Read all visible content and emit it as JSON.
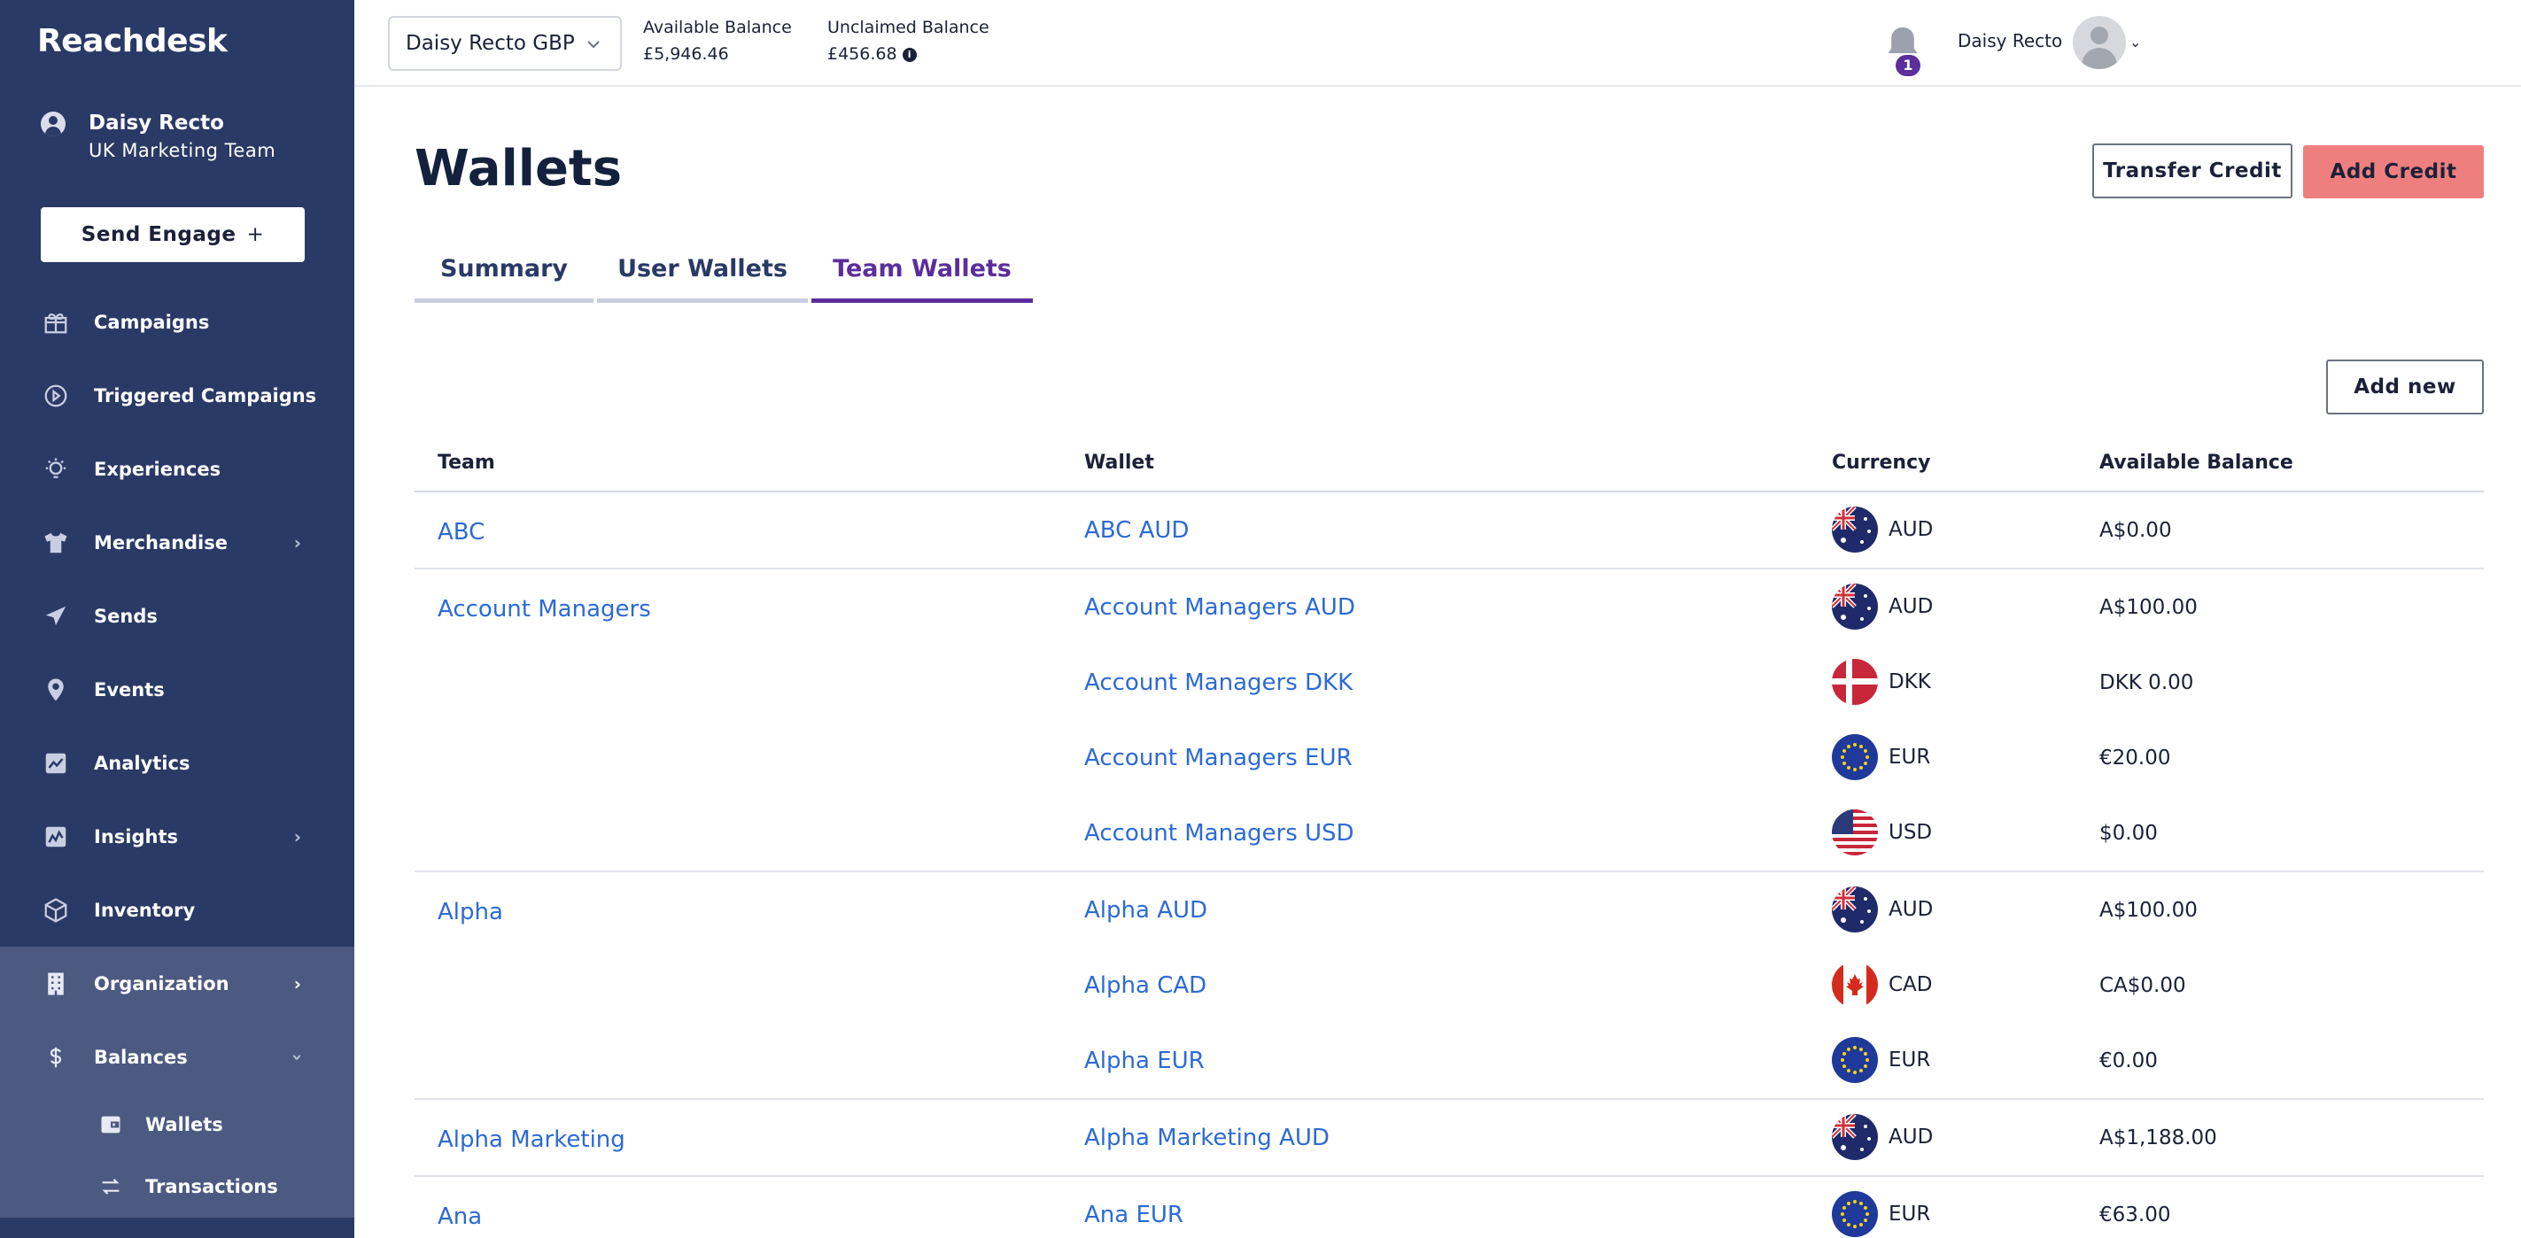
{
  "app": {
    "logo": "Reachdesk"
  },
  "sidebar": {
    "user_name": "Daisy Recto",
    "user_team": "UK Marketing Team",
    "send_button": "Send Engage",
    "send_button_icon": "+",
    "items": [
      {
        "label": "Campaigns",
        "icon": "gift-icon"
      },
      {
        "label": "Triggered Campaigns",
        "icon": "play-circle-icon"
      },
      {
        "label": "Experiences",
        "icon": "lightbulb-icon"
      },
      {
        "label": "Merchandise",
        "icon": "tshirt-icon",
        "has_chevron": true
      },
      {
        "label": "Sends",
        "icon": "paper-plane-icon"
      },
      {
        "label": "Events",
        "icon": "map-pin-icon"
      },
      {
        "label": "Analytics",
        "icon": "analytics-icon"
      },
      {
        "label": "Insights",
        "icon": "insights-icon",
        "has_chevron": true
      },
      {
        "label": "Inventory",
        "icon": "box-icon"
      },
      {
        "label": "Organization",
        "icon": "building-icon",
        "has_chevron": true
      },
      {
        "label": "Balances",
        "icon": "dollar-icon",
        "expanded": true
      }
    ],
    "sub_items": [
      {
        "label": "Wallets",
        "icon": "wallet-icon"
      },
      {
        "label": "Transactions",
        "icon": "arrows-icon"
      }
    ]
  },
  "topbar": {
    "wallet_select": "Daisy Recto GBP",
    "available_label": "Available Balance",
    "available_value": "£5,946.46",
    "unclaimed_label": "Unclaimed Balance",
    "unclaimed_value": "£456.68",
    "notifications_count": "1",
    "user_name": "Daisy Recto"
  },
  "main": {
    "title": "Wallets",
    "transfer_button": "Transfer Credit",
    "add_credit_button": "Add Credit",
    "tabs": [
      {
        "label": "Summary"
      },
      {
        "label": "User Wallets"
      },
      {
        "label": "Team Wallets",
        "active": true
      }
    ],
    "add_new_button": "Add new",
    "columns": {
      "team": "Team",
      "wallet": "Wallet",
      "currency": "Currency",
      "balance": "Available Balance"
    },
    "groups": [
      {
        "team": "ABC",
        "wallets": [
          {
            "name": "ABC AUD",
            "currency": "AUD",
            "flag": "au",
            "balance": "A$0.00"
          }
        ]
      },
      {
        "team": "Account Managers",
        "wallets": [
          {
            "name": "Account Managers AUD",
            "currency": "AUD",
            "flag": "au",
            "balance": "A$100.00"
          },
          {
            "name": "Account Managers DKK",
            "currency": "DKK",
            "flag": "dk",
            "balance": "DKK 0.00"
          },
          {
            "name": "Account Managers EUR",
            "currency": "EUR",
            "flag": "eu",
            "balance": "€20.00"
          },
          {
            "name": "Account Managers USD",
            "currency": "USD",
            "flag": "us",
            "balance": "$0.00"
          }
        ]
      },
      {
        "team": "Alpha",
        "wallets": [
          {
            "name": "Alpha AUD",
            "currency": "AUD",
            "flag": "au",
            "balance": "A$100.00"
          },
          {
            "name": "Alpha CAD",
            "currency": "CAD",
            "flag": "ca",
            "balance": "CA$0.00"
          },
          {
            "name": "Alpha EUR",
            "currency": "EUR",
            "flag": "eu",
            "balance": "€0.00"
          }
        ]
      },
      {
        "team": "Alpha Marketing",
        "wallets": [
          {
            "name": "Alpha Marketing AUD",
            "currency": "AUD",
            "flag": "au",
            "balance": "A$1,188.00"
          }
        ]
      },
      {
        "team": "Ana",
        "wallets": [
          {
            "name": "Ana EUR",
            "currency": "EUR",
            "flag": "eu",
            "balance": "€63.00"
          }
        ]
      }
    ]
  },
  "colors": {
    "sidebar": "#2a3a66",
    "sidebar_active": "#4c5a82",
    "link": "#2c6ad6",
    "accent": "#5b2e9c",
    "add_credit": "#ef7f7f"
  }
}
